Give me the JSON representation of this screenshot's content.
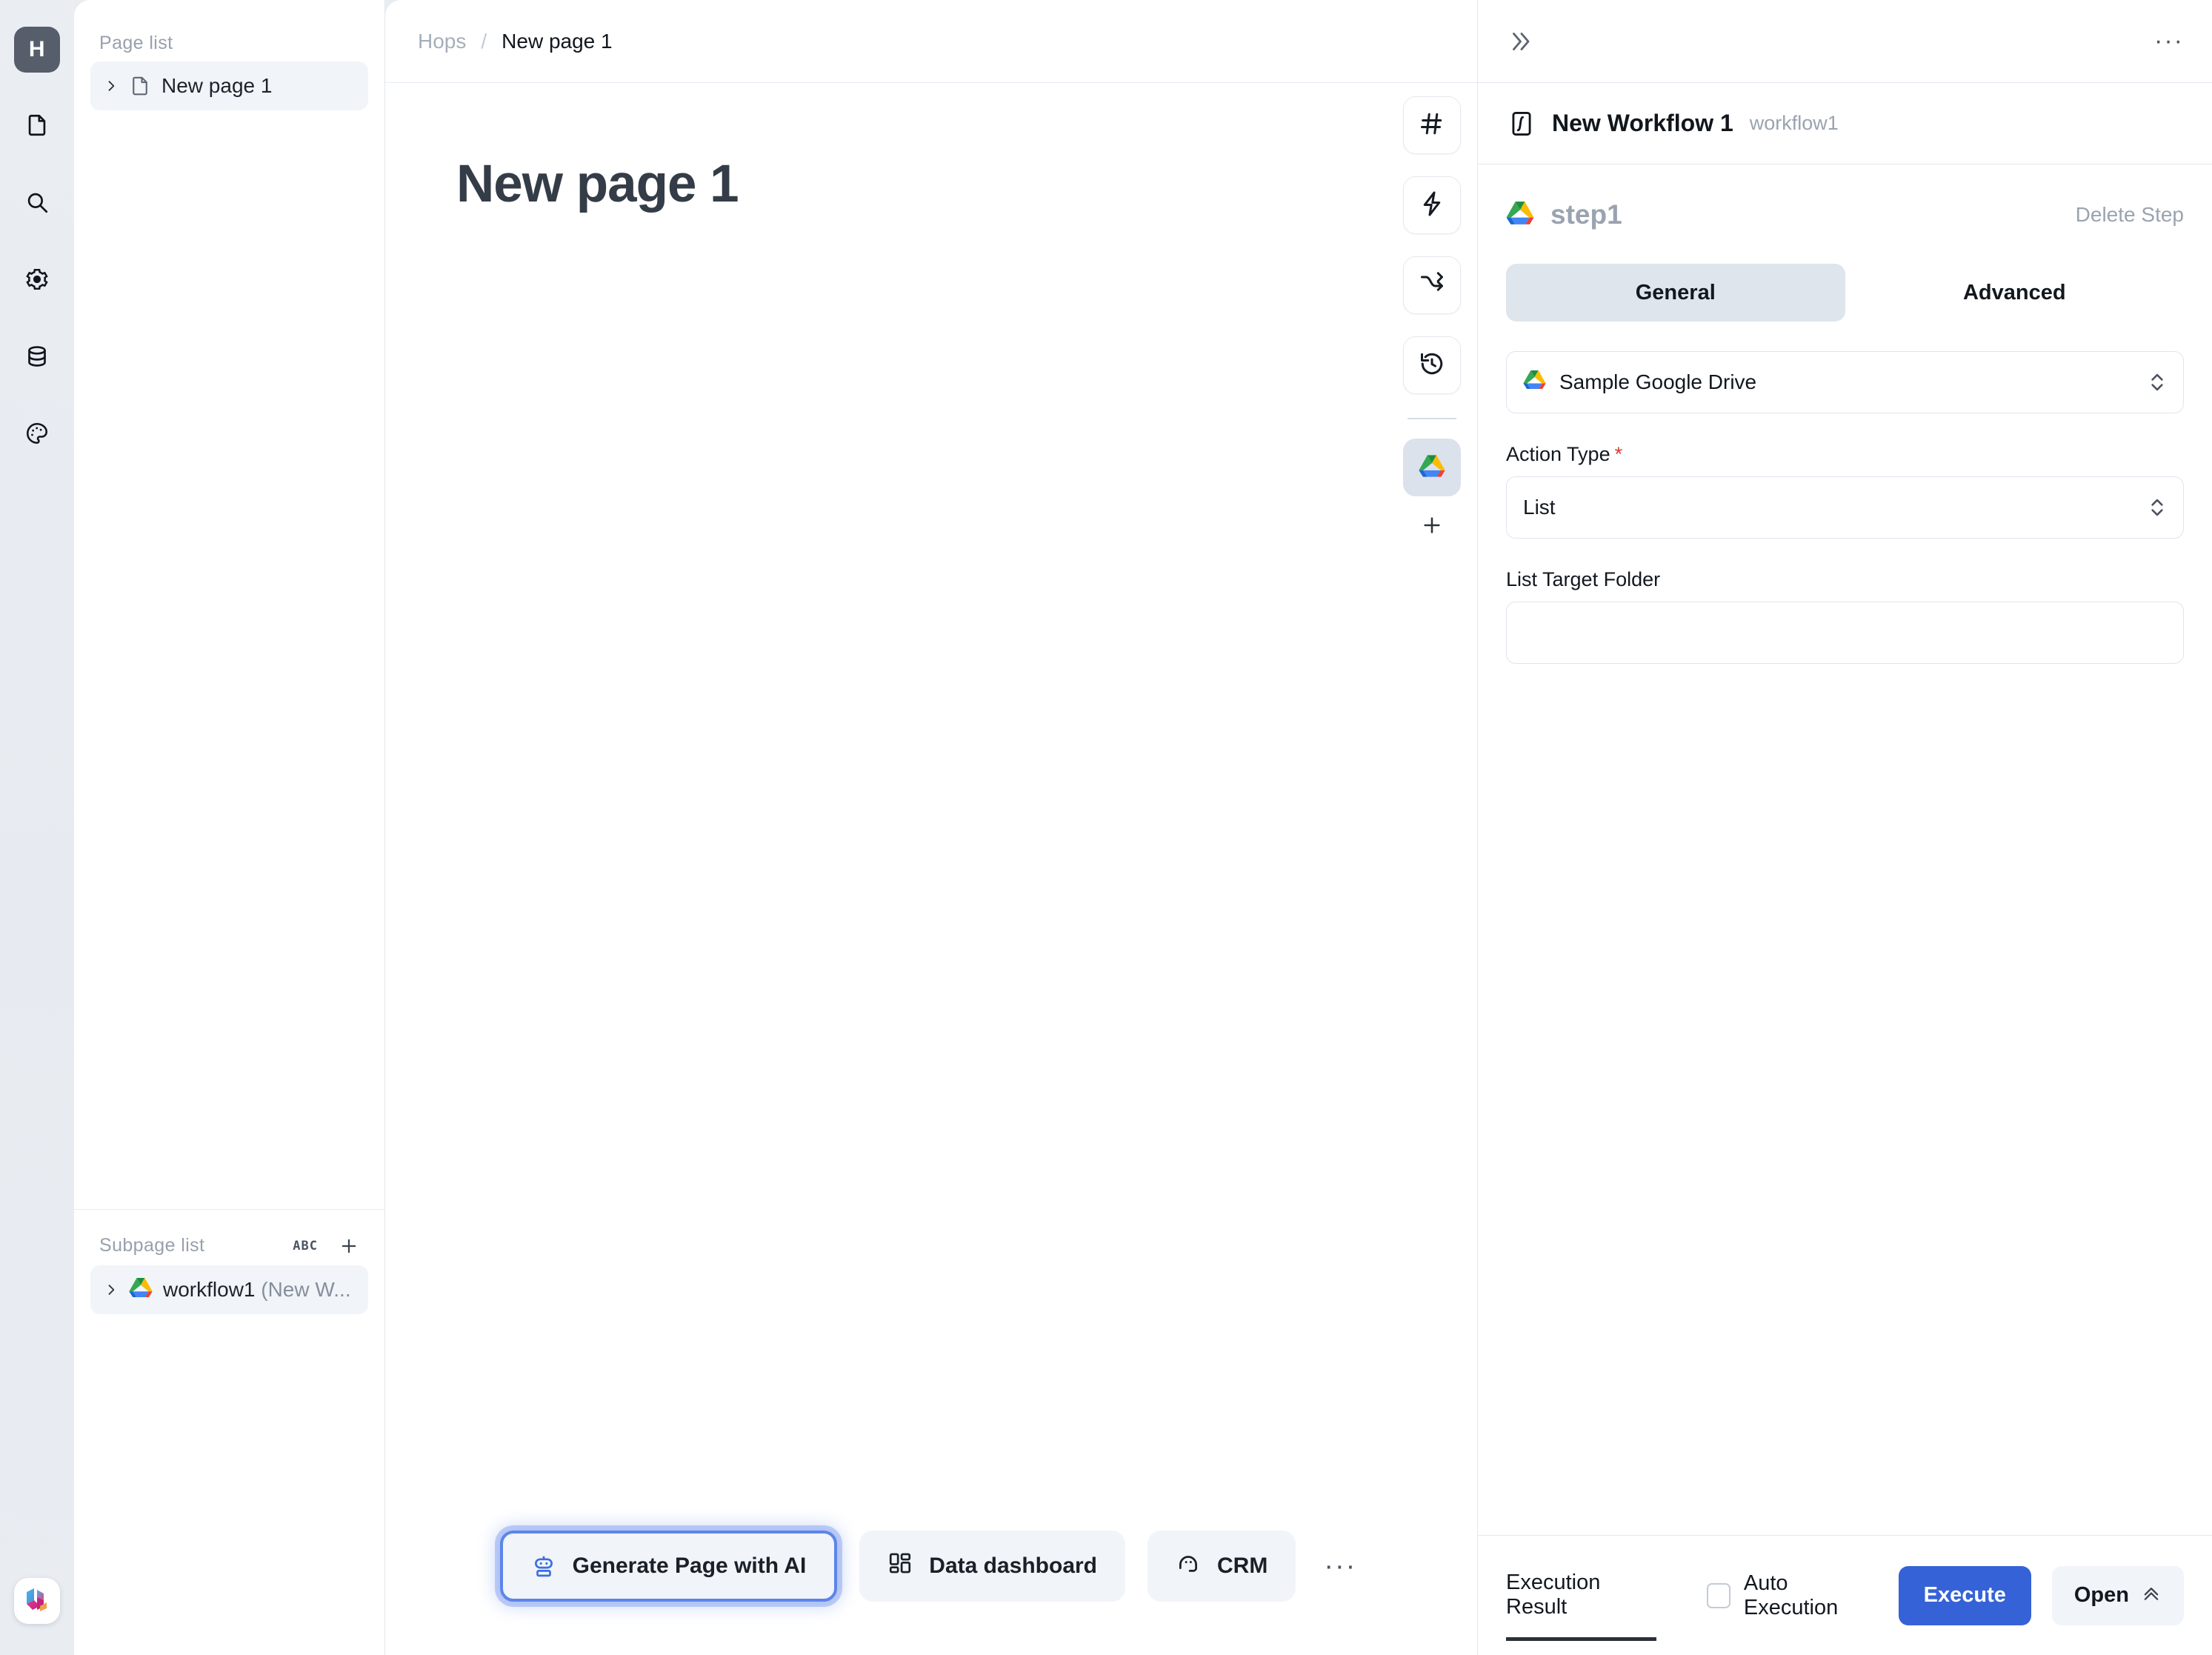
{
  "rail": {
    "logo_text": "H",
    "items": [
      {
        "name": "file-icon",
        "label": "Pages"
      },
      {
        "name": "search-icon",
        "label": "Search"
      },
      {
        "name": "gear-icon",
        "label": "Settings"
      },
      {
        "name": "database-icon",
        "label": "Data"
      },
      {
        "name": "palette-icon",
        "label": "Theme"
      }
    ]
  },
  "page_list": {
    "title": "Page list",
    "items": [
      {
        "label": "New page 1",
        "icon": "file-icon",
        "selected": true
      }
    ],
    "subpage": {
      "title": "Subpage list",
      "sort_icon_label": "ABC",
      "add_icon_label": "+",
      "items": [
        {
          "label": "workflow1 ",
          "suffix": "(New W...",
          "icon": "google-drive-icon",
          "selected": true
        }
      ]
    }
  },
  "breadcrumb": {
    "root": "Hops",
    "separator": "/",
    "current": "New page 1"
  },
  "canvas": {
    "title": "New page 1",
    "toolbar": [
      {
        "name": "hash-icon",
        "active": false
      },
      {
        "name": "lightning-icon",
        "active": false
      },
      {
        "name": "shuffle-icon",
        "active": false
      },
      {
        "name": "history-icon",
        "active": false
      },
      {
        "name": "google-drive-icon",
        "active": true
      }
    ],
    "toolbar_add_label": "+",
    "actions": [
      {
        "label": "Generate Page with AI",
        "icon": "robot-icon",
        "highlighted": true
      },
      {
        "label": "Data dashboard",
        "icon": "dashboard-icon",
        "highlighted": false
      },
      {
        "label": "CRM",
        "icon": "contact-icon",
        "highlighted": false
      }
    ],
    "actions_more_label": "···"
  },
  "right_panel": {
    "collapse_label": "»",
    "more_label": "···",
    "workflow": {
      "name": "New Workflow 1",
      "slug": "workflow1",
      "icon": "workflow-icon"
    },
    "step": {
      "name": "step1",
      "icon": "google-drive-icon",
      "delete_label": "Delete Step",
      "tabs": [
        {
          "label": "General",
          "active": true
        },
        {
          "label": "Advanced",
          "active": false
        }
      ],
      "connection": {
        "value": "Sample Google Drive",
        "icon": "google-drive-icon"
      },
      "fields": [
        {
          "label": "Action Type",
          "required": true,
          "type": "select",
          "value": "List"
        },
        {
          "label": "List Target Folder",
          "required": false,
          "type": "text",
          "value": "",
          "placeholder": ""
        }
      ]
    },
    "footer": {
      "result_tab": "Execution Result",
      "auto_execution_label": "Auto Execution",
      "auto_execution_checked": false,
      "execute_label": "Execute",
      "open_label": "Open",
      "accent_color": "#3562d6"
    }
  }
}
